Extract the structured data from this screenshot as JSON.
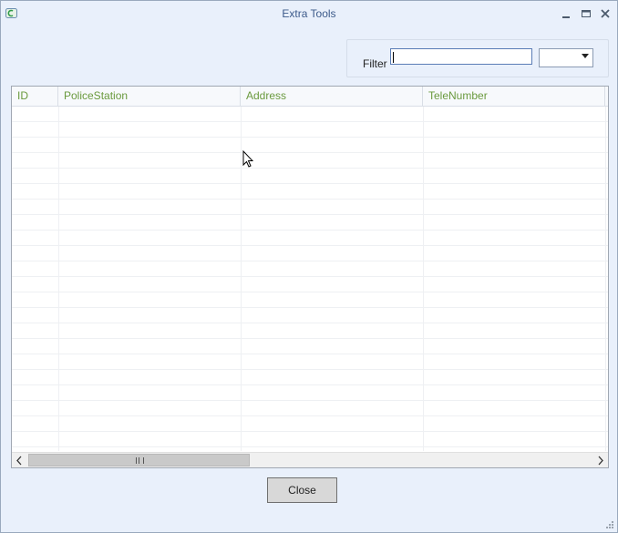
{
  "window": {
    "title": "Extra Tools",
    "minimize_icon": "minimize-icon",
    "maximize_icon": "maximize-icon",
    "close_icon": "close-icon"
  },
  "filter": {
    "label": "Filter",
    "value": "",
    "placeholder": "",
    "select_value": ""
  },
  "grid": {
    "columns": [
      "ID",
      "PoliceStation",
      "Address",
      "TeleNumber"
    ],
    "rows": []
  },
  "buttons": {
    "close_label": "Close"
  },
  "colors": {
    "header_text": "#6a9a3e",
    "window_bg": "#e9f0fb",
    "title_text": "#3c5a8a"
  }
}
